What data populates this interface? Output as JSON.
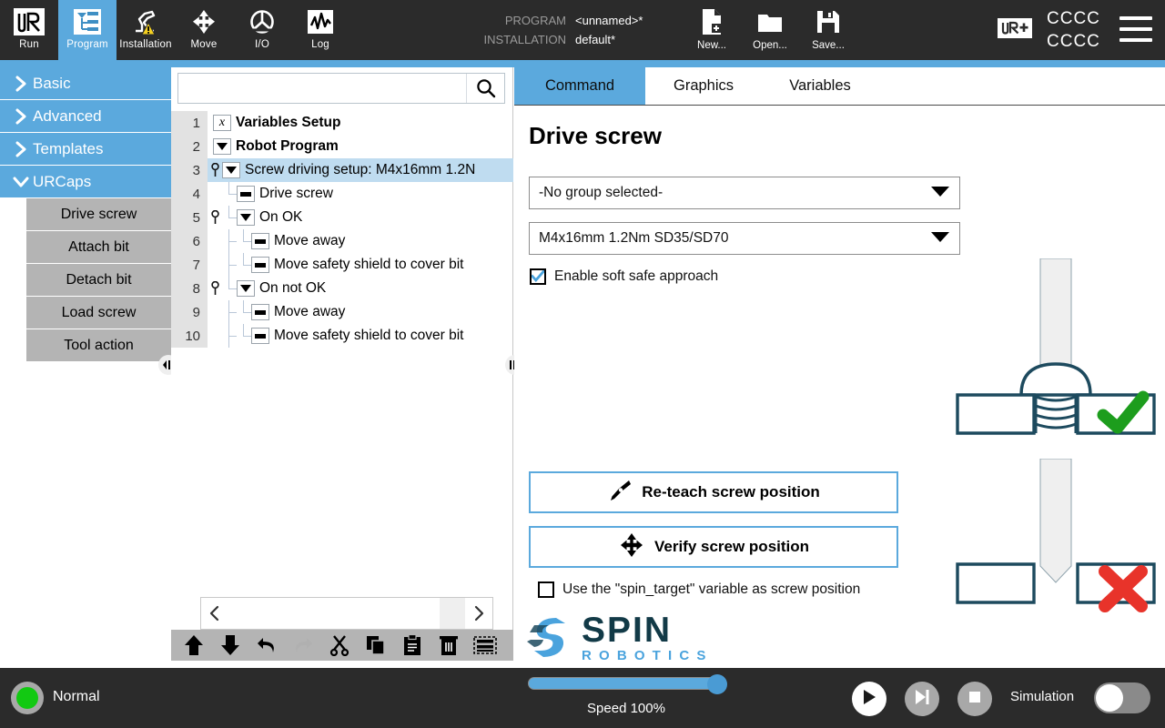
{
  "header": {
    "nav_tabs": [
      {
        "label": "Run",
        "icon": "ur-logo-icon",
        "active": false
      },
      {
        "label": "Program",
        "icon": "program-tree-icon",
        "active": true
      },
      {
        "label": "Installation",
        "icon": "robot-arm-warning-icon",
        "active": false
      },
      {
        "label": "Move",
        "icon": "move-arrows-icon",
        "active": false
      },
      {
        "label": "I/O",
        "icon": "io-gauge-icon",
        "active": false
      },
      {
        "label": "Log",
        "icon": "log-waveform-icon",
        "active": false
      }
    ],
    "program_key": "PROGRAM",
    "program_value": "<unnamed>*",
    "installation_key": "INSTALLATION",
    "installation_value": "default*",
    "file_actions": [
      {
        "label": "New...",
        "icon": "new-file-icon"
      },
      {
        "label": "Open...",
        "icon": "open-folder-icon"
      },
      {
        "label": "Save...",
        "icon": "save-floppy-icon"
      }
    ],
    "urplus_icon": "ur-plus-icon",
    "account_line1": "CCCC",
    "account_line2": "CCCC",
    "menu_icon": "hamburger-menu-icon",
    "accent_color": "#5ba9dd",
    "bar_color": "#2b2b2b"
  },
  "sidebar": {
    "categories": [
      {
        "label": "Basic",
        "expanded": false,
        "icon": "chevron-right-icon"
      },
      {
        "label": "Advanced",
        "expanded": false,
        "icon": "chevron-right-icon"
      },
      {
        "label": "Templates",
        "expanded": false,
        "icon": "chevron-right-icon"
      },
      {
        "label": "URCaps",
        "expanded": true,
        "icon": "chevron-down-icon"
      }
    ],
    "urcaps_items": [
      {
        "label": "Drive screw"
      },
      {
        "label": "Attach bit"
      },
      {
        "label": "Detach bit"
      },
      {
        "label": "Load screw"
      },
      {
        "label": "Tool action"
      }
    ]
  },
  "tree_panel": {
    "search": {
      "value": "",
      "placeholder": "",
      "icon": "search-icon"
    },
    "rows": [
      {
        "num": "1",
        "label": "Variables Setup",
        "icon": "variable-x-icon",
        "indent": 0,
        "bold": true,
        "selected": false,
        "breakpoint": false
      },
      {
        "num": "2",
        "label": "Robot Program",
        "icon": "folder-triangle-icon",
        "indent": 0,
        "bold": true,
        "selected": false,
        "breakpoint": false
      },
      {
        "num": "3",
        "label": "Screw driving setup: M4x16mm 1.2N",
        "icon": "folder-triangle-icon",
        "indent": 1,
        "bold": false,
        "selected": true,
        "breakpoint": true
      },
      {
        "num": "4",
        "label": "Drive screw",
        "icon": "command-bar-icon",
        "indent": 2,
        "bold": false,
        "selected": false,
        "breakpoint": false
      },
      {
        "num": "5",
        "label": "On OK",
        "icon": "folder-triangle-icon",
        "indent": 2,
        "bold": false,
        "selected": false,
        "breakpoint": true
      },
      {
        "num": "6",
        "label": "Move away",
        "icon": "command-bar-icon",
        "indent": 3,
        "bold": false,
        "selected": false,
        "breakpoint": false
      },
      {
        "num": "7",
        "label": "Move safety shield to cover bit",
        "icon": "command-bar-icon",
        "indent": 3,
        "bold": false,
        "selected": false,
        "breakpoint": false
      },
      {
        "num": "8",
        "label": "On not OK",
        "icon": "folder-triangle-icon",
        "indent": 2,
        "bold": false,
        "selected": false,
        "breakpoint": true
      },
      {
        "num": "9",
        "label": "Move away",
        "icon": "command-bar-icon",
        "indent": 3,
        "bold": false,
        "selected": false,
        "breakpoint": false
      },
      {
        "num": "10",
        "label": "Move safety shield to cover bit",
        "icon": "command-bar-icon",
        "indent": 3,
        "bold": false,
        "selected": false,
        "breakpoint": false
      }
    ],
    "hscroll": {
      "left_icon": "chevron-left-icon",
      "right_icon": "chevron-right-icon"
    },
    "toolbar": [
      {
        "name": "move-up-button",
        "icon": "arrow-up-icon"
      },
      {
        "name": "move-down-button",
        "icon": "arrow-down-icon"
      },
      {
        "name": "undo-button",
        "icon": "undo-arrow-icon"
      },
      {
        "name": "redo-button",
        "icon": "redo-arrow-icon"
      },
      {
        "name": "cut-button",
        "icon": "scissors-icon"
      },
      {
        "name": "copy-button",
        "icon": "copy-pages-icon"
      },
      {
        "name": "paste-button",
        "icon": "clipboard-icon"
      },
      {
        "name": "delete-button",
        "icon": "trash-can-icon"
      },
      {
        "name": "suppress-button",
        "icon": "suppress-lines-icon"
      }
    ]
  },
  "main": {
    "tabs": [
      {
        "label": "Command",
        "active": true
      },
      {
        "label": "Graphics",
        "active": false
      },
      {
        "label": "Variables",
        "active": false
      }
    ],
    "title": "Drive screw",
    "group_select": {
      "value": "-No group selected-",
      "icon": "chevron-down-icon"
    },
    "screw_select": {
      "value": "M4x16mm 1.2Nm SD35/SD70",
      "icon": "chevron-down-icon"
    },
    "soft_approach": {
      "label": "Enable soft safe approach",
      "checked": true
    },
    "reteach_button": {
      "label": "Re-teach screw position",
      "icon": "reteach-screwdriver-icon"
    },
    "verify_button": {
      "label": "Verify screw position",
      "icon": "move-arrows-icon"
    },
    "spin_target": {
      "label": "Use the \"spin_target\" variable as screw position",
      "checked": false
    },
    "brand": {
      "name": "SPIN",
      "sub": "R O B O T I C S",
      "icon": "spin-robotics-logo-icon"
    },
    "illustration": {
      "ok_mark": "green-check-icon",
      "not_ok_mark": "red-cross-icon",
      "ok_color": "#1d9d1d",
      "not_ok_color": "#e8332a",
      "outline_color": "#1d4a5e"
    }
  },
  "bottom": {
    "status_text": "Normal",
    "status_color": "#12c912",
    "speed_label": "Speed 100%",
    "speed_percent": 100,
    "play_icon": "play-icon",
    "step_icon": "step-icon",
    "stop_icon": "stop-icon",
    "simulation_label": "Simulation",
    "simulation_on": false
  }
}
